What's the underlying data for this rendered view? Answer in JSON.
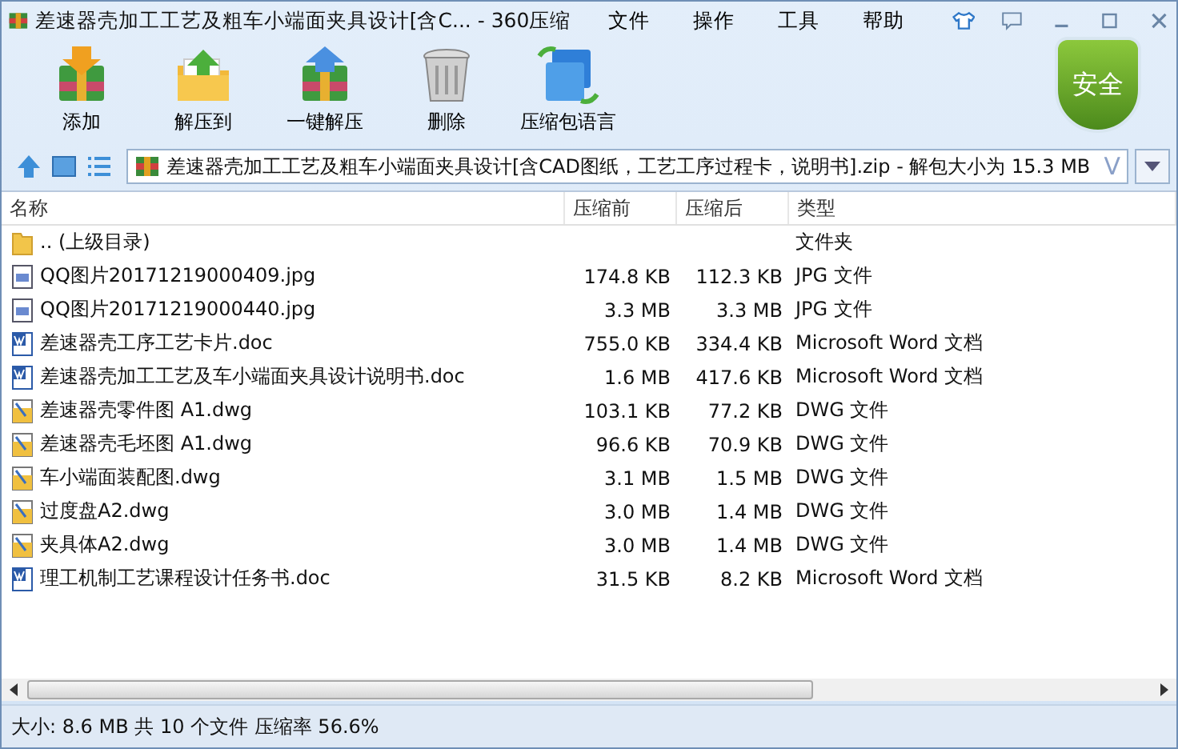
{
  "window": {
    "title": "差速器壳加工工艺及粗车小端面夹具设计[含C... - 360压缩"
  },
  "menu": [
    "文件",
    "操作",
    "工具",
    "帮助"
  ],
  "toolbar": [
    {
      "label": "添加",
      "kind": "add"
    },
    {
      "label": "解压到",
      "kind": "extract"
    },
    {
      "label": "一键解压",
      "kind": "quick"
    },
    {
      "label": "删除",
      "kind": "delete"
    },
    {
      "label": "压缩包语言",
      "kind": "language"
    }
  ],
  "security_badge": "安全",
  "address": {
    "value": "差速器壳加工工艺及粗车小端面夹具设计[含CAD图纸，工艺工序过程卡，说明书].zip - 解包大小为 15.3 MB",
    "verified_mark": "V"
  },
  "table": {
    "columns": [
      "名称",
      "压缩前",
      "压缩后",
      "类型"
    ],
    "rows": [
      {
        "kind": "folder",
        "name": ".. (上级目录)",
        "before": "",
        "after": "",
        "type": "文件夹"
      },
      {
        "kind": "image",
        "name": "QQ图片20171219000409.jpg",
        "before": "174.8 KB",
        "after": "112.3 KB",
        "type": "JPG 文件"
      },
      {
        "kind": "image",
        "name": "QQ图片20171219000440.jpg",
        "before": "3.3 MB",
        "after": "3.3 MB",
        "type": "JPG 文件"
      },
      {
        "kind": "word",
        "name": "差速器壳工序工艺卡片.doc",
        "before": "755.0 KB",
        "after": "334.4 KB",
        "type": "Microsoft Word 文档"
      },
      {
        "kind": "word",
        "name": "差速器壳加工工艺及车小端面夹具设计说明书.doc",
        "before": "1.6 MB",
        "after": "417.6 KB",
        "type": "Microsoft Word 文档"
      },
      {
        "kind": "dwg",
        "name": "差速器壳零件图 A1.dwg",
        "before": "103.1 KB",
        "after": "77.2 KB",
        "type": "DWG 文件"
      },
      {
        "kind": "dwg",
        "name": "差速器壳毛坯图 A1.dwg",
        "before": "96.6 KB",
        "after": "70.9 KB",
        "type": "DWG 文件"
      },
      {
        "kind": "dwg",
        "name": "车小端面装配图.dwg",
        "before": "3.1 MB",
        "after": "1.5 MB",
        "type": "DWG 文件"
      },
      {
        "kind": "dwg",
        "name": "过度盘A2.dwg",
        "before": "3.0 MB",
        "after": "1.4 MB",
        "type": "DWG 文件"
      },
      {
        "kind": "dwg",
        "name": "夹具体A2.dwg",
        "before": "3.0 MB",
        "after": "1.4 MB",
        "type": "DWG 文件"
      },
      {
        "kind": "word",
        "name": "理工机制工艺课程设计任务书.doc",
        "before": "31.5 KB",
        "after": "8.2 KB",
        "type": "Microsoft Word 文档"
      }
    ]
  },
  "status_bar": "大小: 8.6 MB 共 10 个文件 压缩率 56.6%"
}
